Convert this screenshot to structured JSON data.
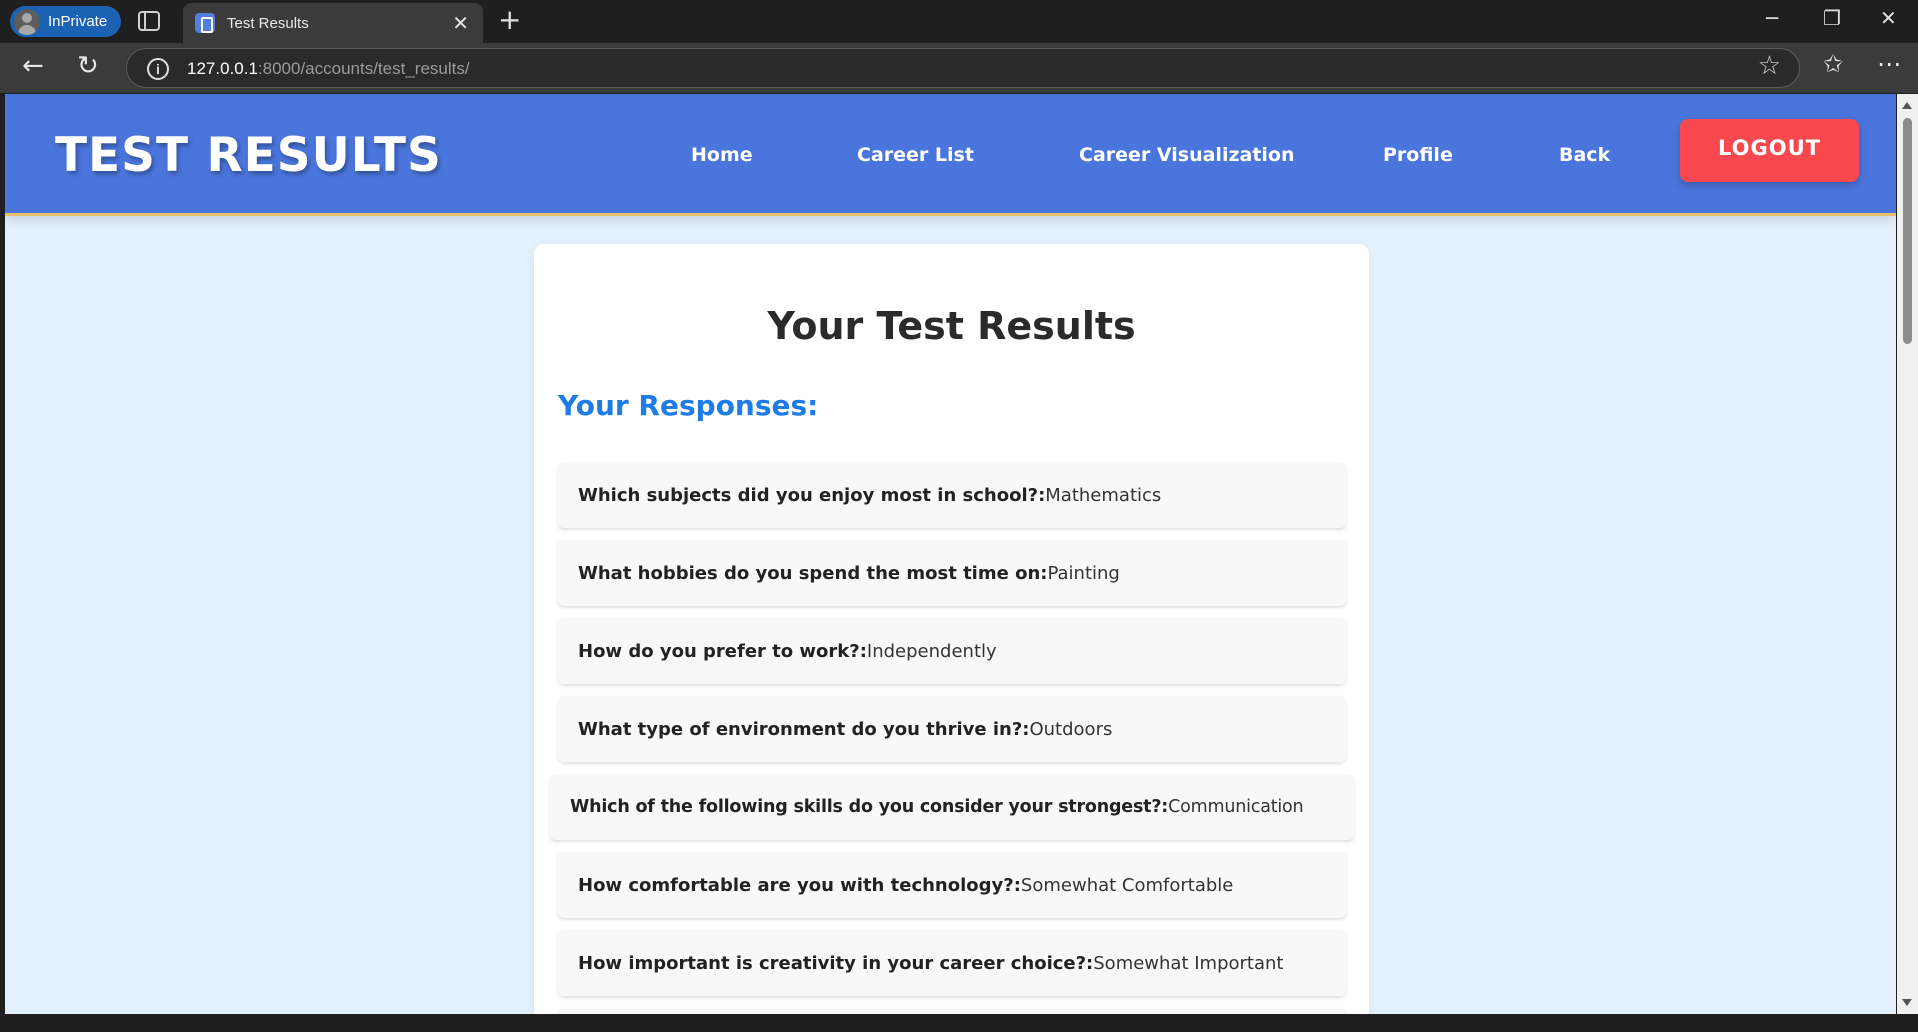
{
  "browser": {
    "profile_label": "InPrivate",
    "tab_title": "Test Results",
    "url_host": "127.0.0.1",
    "url_rest": ":8000/accounts/test_results/"
  },
  "header": {
    "site_title": "TEST RESULTS",
    "nav": [
      "Home",
      "Career List",
      "Career Visualization",
      "Profile",
      "Back"
    ],
    "logout_label": "LOGOUT"
  },
  "main": {
    "title": "Your Test Results",
    "responses_heading": "Your Responses:",
    "responses": [
      {
        "q": "Which subjects did you enjoy most in school?:",
        "a": " Mathematics"
      },
      {
        "q": "What hobbies do you spend the most time on:",
        "a": " Painting"
      },
      {
        "q": "How do you prefer to work?:",
        "a": " Independently"
      },
      {
        "q": "What type of environment do you thrive in?:",
        "a": " Outdoors"
      },
      {
        "q": "Which of the following skills do you consider your strongest?:",
        "a": " Communication"
      },
      {
        "q": "How comfortable are you with technology?:",
        "a": " Somewhat Comfortable"
      },
      {
        "q": "How important is creativity in your career choice?:",
        "a": " Somewhat Important"
      }
    ]
  },
  "colors": {
    "header_bg": "#4a75dc",
    "page_bg": "#e3f0fd",
    "logout_bg": "#f7474f",
    "heading_blue": "#1f7be6"
  }
}
